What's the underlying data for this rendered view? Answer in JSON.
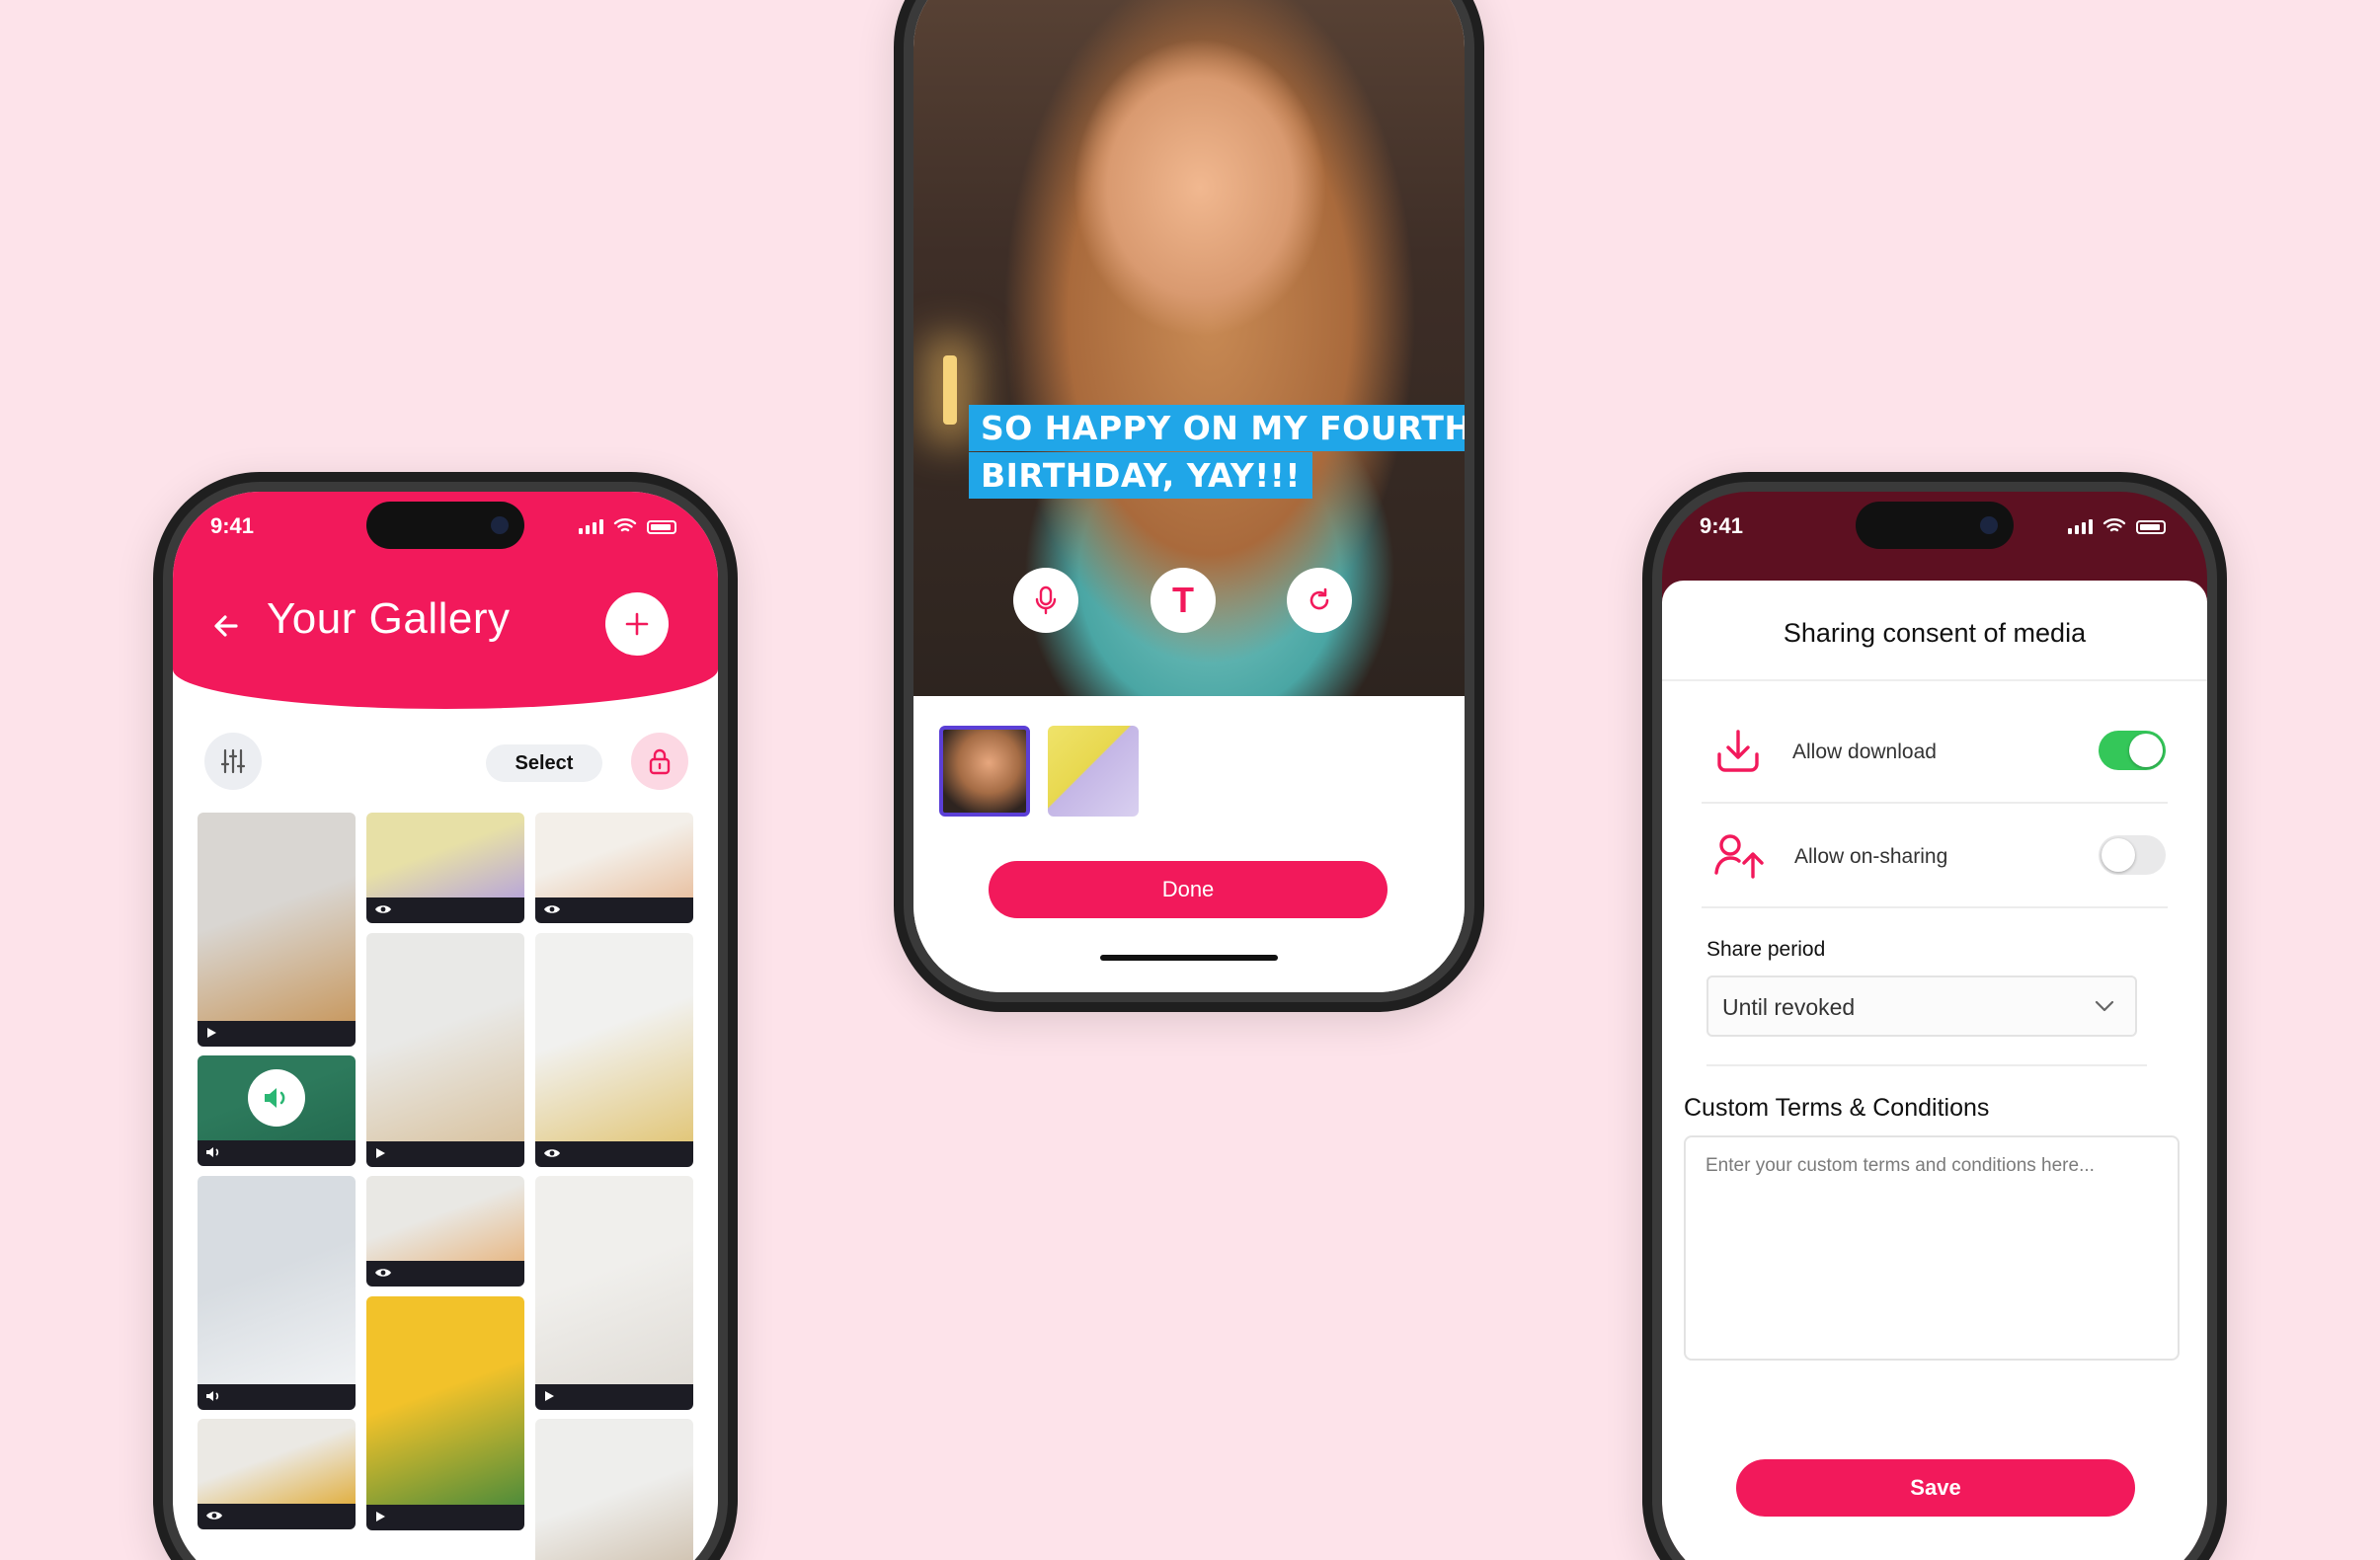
{
  "status": {
    "time": "9:41"
  },
  "gallery": {
    "title": "Your Gallery",
    "back_icon": "arrow-left-icon",
    "add_icon": "plus-icon",
    "select_label": "Select",
    "filter_icon": "sliders-icon",
    "lock_icon": "lock-icon",
    "tiles": [
      {
        "badge": "play",
        "colors": [
          "#d9d6d2",
          "#c89a62"
        ]
      },
      {
        "badge": "view",
        "colors": [
          "#e7e0a6",
          "#b9a7d8"
        ]
      },
      {
        "badge": "view",
        "colors": [
          "#f3efe9",
          "#e9c2a3"
        ]
      },
      {
        "badge": "audio",
        "colors": [
          "#2d7a5c",
          "#246b50"
        ]
      },
      {
        "badge": "play",
        "colors": [
          "#e9e9e7",
          "#d9c3a0"
        ]
      },
      {
        "badge": "view",
        "colors": [
          "#f1f1ef",
          "#e2c77a"
        ]
      },
      {
        "badge": "audio",
        "colors": [
          "#d7dce1",
          "#f0f2f4"
        ]
      },
      {
        "badge": "view",
        "colors": [
          "#e9e8e4",
          "#e7b987"
        ]
      },
      {
        "badge": "play",
        "colors": [
          "#f0efec",
          "#e0dcd6"
        ]
      },
      {
        "badge": "view",
        "colors": [
          "#ebe9e4",
          "#e1b043"
        ]
      },
      {
        "badge": "play",
        "colors": [
          "#f2c22a",
          "#4f8c3a"
        ]
      },
      {
        "badge": "none",
        "colors": [
          "#eeeeec",
          "#c9b8a2"
        ]
      }
    ]
  },
  "editor": {
    "caption_lines": [
      "SO HAPPY ON MY FOURTH",
      "BIRTHDAY, YAY!!!"
    ],
    "controls": [
      {
        "icon": "microphone-icon",
        "label": ""
      },
      {
        "icon": "text-icon",
        "label": "T"
      },
      {
        "icon": "rotate-icon",
        "label": ""
      }
    ],
    "done_label": "Done"
  },
  "consent": {
    "title": "Sharing consent of media",
    "rows": [
      {
        "icon": "download-icon",
        "label": "Allow download",
        "enabled": true
      },
      {
        "icon": "share-user-icon",
        "label": "Allow on-sharing",
        "enabled": false
      }
    ],
    "share_period_label": "Share period",
    "share_period_value": "Until revoked",
    "terms_label": "Custom Terms & Conditions",
    "terms_placeholder": "Enter your custom terms and conditions here...",
    "save_label": "Save"
  },
  "colors": {
    "accent": "#f2195b",
    "toggle_on": "#34c759",
    "toggle_off": "#e9e9ea",
    "caption_bg": "#20a6e8",
    "consent_status": "#5d1021"
  }
}
